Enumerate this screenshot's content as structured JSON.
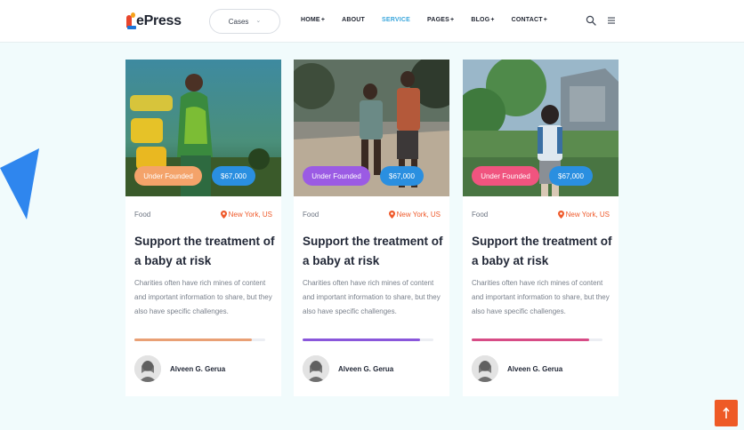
{
  "brand": {
    "logo_text": "ePress"
  },
  "header": {
    "cases_label": "Cases",
    "nav": [
      {
        "label": "HOME",
        "plus": "+",
        "active": false
      },
      {
        "label": "ABOUT",
        "plus": "",
        "active": false
      },
      {
        "label": "SERVICE",
        "plus": "",
        "active": true
      },
      {
        "label": "PAGES",
        "plus": "+",
        "active": false
      },
      {
        "label": "BLOG",
        "plus": "+",
        "active": false
      },
      {
        "label": "CONTACT",
        "plus": "+",
        "active": false
      }
    ],
    "icons": [
      "search-icon",
      "menu-icon"
    ]
  },
  "cards": [
    {
      "status": "Under Founded",
      "status_color": "#f4a36a",
      "amount": "$67,000",
      "category": "Food",
      "location": "New York, US",
      "title": "Support the treatment of a baby at risk",
      "description": "Charities often have rich mines of content and important information to share, but they also have specific challenges.",
      "progress": 0.9,
      "progress_color": "#e9a075",
      "author": "Alveen G. Gerua"
    },
    {
      "status": "Under Founded",
      "status_color": "#9b5be4",
      "amount": "$67,000",
      "category": "Food",
      "location": "New York, US",
      "title": "Support the treatment of a baby at risk",
      "description": "Charities often have rich mines of content and important information to share, but they also have specific challenges.",
      "progress": 0.9,
      "progress_color": "#8a57db",
      "author": "Alveen G. Gerua"
    },
    {
      "status": "Under Founded",
      "status_color": "#f0547f",
      "amount": "$67,000",
      "category": "Food",
      "location": "New York, US",
      "title": "Support the treatment of a baby at risk",
      "description": "Charities often have rich mines of content and important information to share, but they also have specific challenges.",
      "progress": 0.9,
      "progress_color": "#d74c86",
      "author": "Alveen G. Gerua"
    }
  ],
  "colors": {
    "accent": "#3aa6dc",
    "amount_pill": "#2a8fe0",
    "to_top": "#ee5a26",
    "background": "#f1fbfc"
  }
}
